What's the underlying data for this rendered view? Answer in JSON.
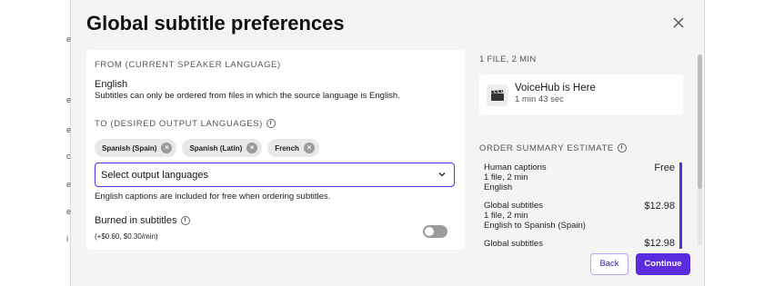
{
  "dialog": {
    "title": "Global subtitle preferences"
  },
  "from": {
    "label": "FROM (CURRENT SPEAKER LANGUAGE)",
    "language": "English",
    "note": "Subtitles can only be ordered from files in which the source language is English."
  },
  "to": {
    "label": "TO (DESIRED OUTPUT LANGUAGES)",
    "chips": [
      {
        "label": "Spanish (Spain)"
      },
      {
        "label": "Spanish (Latin)"
      },
      {
        "label": "French"
      }
    ],
    "select_placeholder": "Select output languages",
    "note": "English captions are included for free when ordering subtitles."
  },
  "burned": {
    "label": "Burned in subtitles",
    "price": "(+$0.60, $0.30/min)",
    "enabled": false
  },
  "files": {
    "header": "1 FILE, 2 MIN",
    "item": {
      "name": "VoiceHub is Here",
      "duration": "1 min 43 sec",
      "icon": "clapperboard-icon"
    }
  },
  "summary": {
    "header": "ORDER SUMMARY ESTIMATE",
    "rows": [
      {
        "title": "Human captions",
        "line2": "1 file, 2 min",
        "line3": "English",
        "price": "Free"
      },
      {
        "title": "Global subtitles",
        "line2": "1 file, 2 min",
        "line3": "English to Spanish (Spain)",
        "price": "$12.98"
      },
      {
        "title": "Global subtitles",
        "line2": "",
        "line3": "",
        "price": "$12.98"
      }
    ]
  },
  "actions": {
    "back": "Back",
    "continue": "Continue"
  },
  "colors": {
    "accent": "#5b2be0",
    "dialog_bg": "#f4f4f4"
  }
}
